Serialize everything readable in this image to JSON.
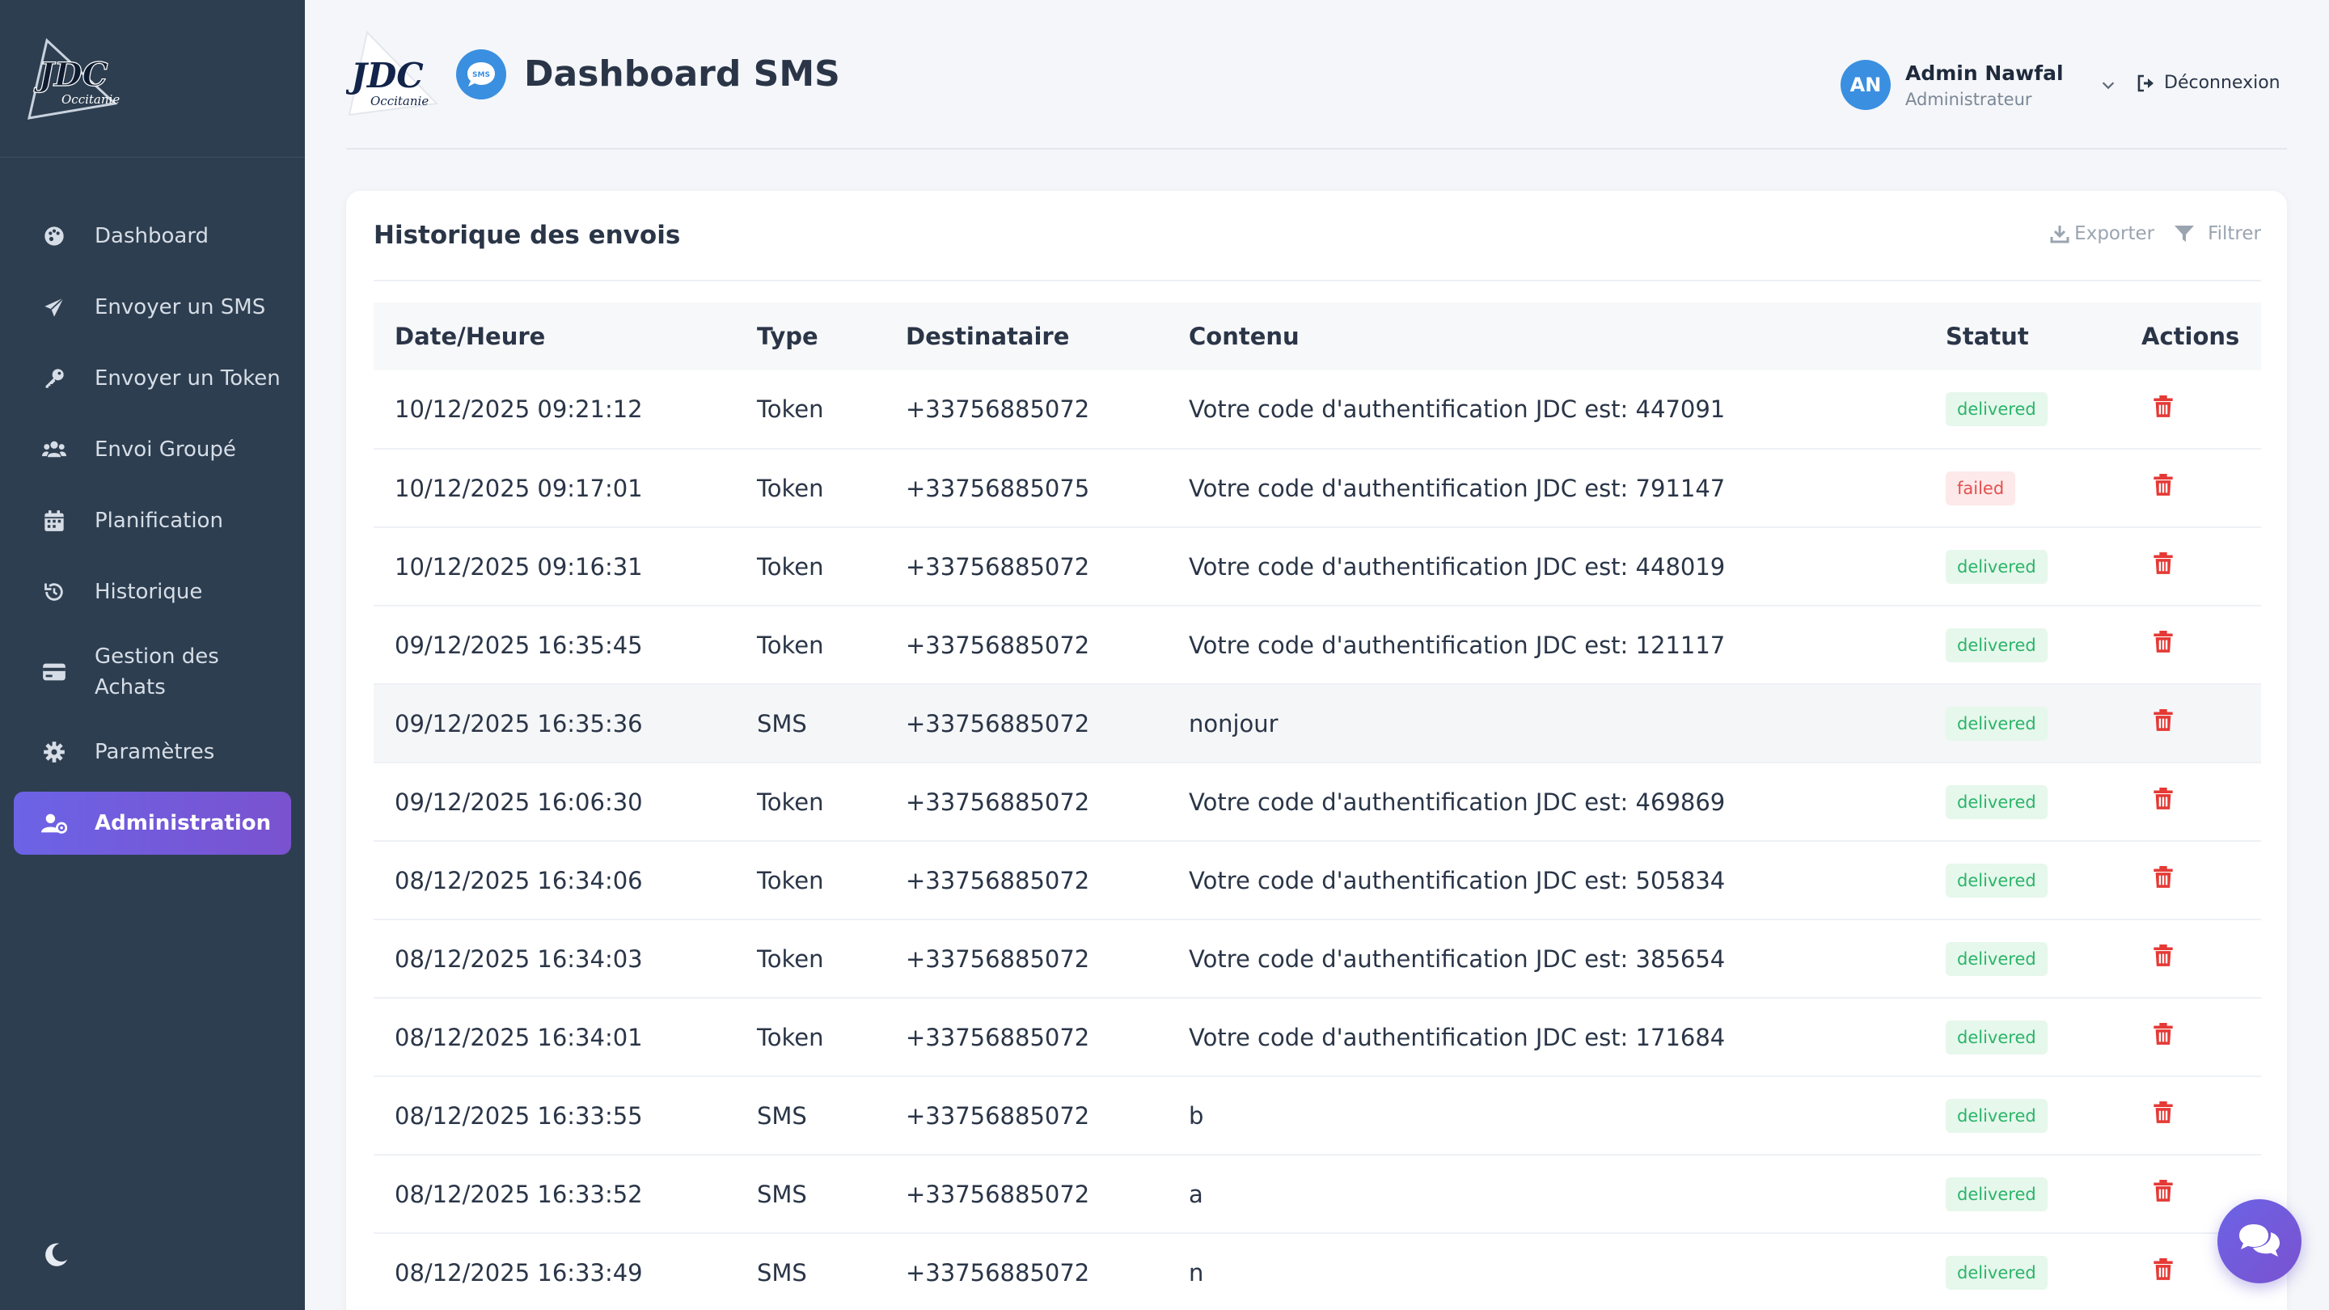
{
  "brand": {
    "logo_text": "JDC",
    "logo_sub": "Occitanie"
  },
  "sidebar": {
    "items": [
      {
        "label": "Dashboard",
        "icon": "palette-icon"
      },
      {
        "label": "Envoyer un SMS",
        "icon": "paper-plane-icon"
      },
      {
        "label": "Envoyer un Token",
        "icon": "key-icon"
      },
      {
        "label": "Envoi Groupé",
        "icon": "users-icon"
      },
      {
        "label": "Planification",
        "icon": "calendar-icon"
      },
      {
        "label": "Historique",
        "icon": "history-icon"
      },
      {
        "label": "Gestion des Achats",
        "icon": "credit-card-icon"
      },
      {
        "label": "Paramètres",
        "icon": "gear-icon"
      },
      {
        "label": "Administration",
        "icon": "user-cog-icon",
        "active": true
      }
    ],
    "theme_toggle_icon": "moon-icon"
  },
  "header": {
    "title": "Dashboard SMS",
    "sms_badge": "SMS",
    "user": {
      "initials": "AN",
      "name": "Admin Nawfal",
      "role": "Administrateur"
    },
    "logout_label": "Déconnexion"
  },
  "history": {
    "title": "Historique des envois",
    "export_label": "Exporter",
    "filter_label": "Filtrer",
    "columns": [
      "Date/Heure",
      "Type",
      "Destinataire",
      "Contenu",
      "Statut",
      "Actions"
    ],
    "rows": [
      {
        "date": "10/12/2025 09:21:12",
        "type": "Token",
        "to": "+33756885072",
        "content": "Votre code d'authentification JDC est: 447091",
        "status": "delivered"
      },
      {
        "date": "10/12/2025 09:17:01",
        "type": "Token",
        "to": "+33756885075",
        "content": "Votre code d'authentification JDC est: 791147",
        "status": "failed"
      },
      {
        "date": "10/12/2025 09:16:31",
        "type": "Token",
        "to": "+33756885072",
        "content": "Votre code d'authentification JDC est: 448019",
        "status": "delivered"
      },
      {
        "date": "09/12/2025 16:35:45",
        "type": "Token",
        "to": "+33756885072",
        "content": "Votre code d'authentification JDC est: 121117",
        "status": "delivered"
      },
      {
        "date": "09/12/2025 16:35:36",
        "type": "SMS",
        "to": "+33756885072",
        "content": "nonjour",
        "status": "delivered"
      },
      {
        "date": "09/12/2025 16:06:30",
        "type": "Token",
        "to": "+33756885072",
        "content": "Votre code d'authentification JDC est: 469869",
        "status": "delivered"
      },
      {
        "date": "08/12/2025 16:34:06",
        "type": "Token",
        "to": "+33756885072",
        "content": "Votre code d'authentification JDC est: 505834",
        "status": "delivered"
      },
      {
        "date": "08/12/2025 16:34:03",
        "type": "Token",
        "to": "+33756885072",
        "content": "Votre code d'authentification JDC est: 385654",
        "status": "delivered"
      },
      {
        "date": "08/12/2025 16:34:01",
        "type": "Token",
        "to": "+33756885072",
        "content": "Votre code d'authentification JDC est: 171684",
        "status": "delivered"
      },
      {
        "date": "08/12/2025 16:33:55",
        "type": "SMS",
        "to": "+33756885072",
        "content": "b",
        "status": "delivered"
      },
      {
        "date": "08/12/2025 16:33:52",
        "type": "SMS",
        "to": "+33756885072",
        "content": "a",
        "status": "delivered"
      },
      {
        "date": "08/12/2025 16:33:49",
        "type": "SMS",
        "to": "+33756885072",
        "content": "n",
        "status": "delivered"
      }
    ]
  },
  "colors": {
    "sidebar": "#2d3e50",
    "accent": "#6c63e6",
    "delivered": "#2bb569",
    "failed": "#e4504e",
    "delete": "#e53935"
  }
}
